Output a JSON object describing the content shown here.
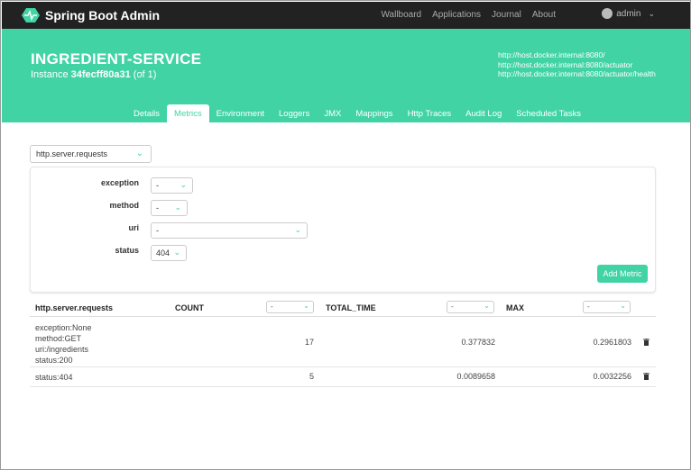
{
  "app": {
    "brand": "Spring Boot Admin",
    "nav": [
      "Wallboard",
      "Applications",
      "Journal",
      "About"
    ],
    "user": "admin"
  },
  "service": {
    "name": "INGREDIENT-SERVICE",
    "instance_prefix": "Instance",
    "instance_id": "34fecff80a31",
    "instance_suffix": "(of 1)",
    "urls": [
      "http://host.docker.internal:8080/",
      "http://host.docker.internal:8080/actuator",
      "http://host.docker.internal:8080/actuator/health"
    ]
  },
  "tabs": [
    {
      "label": "Details"
    },
    {
      "label": "Metrics",
      "active": true
    },
    {
      "label": "Environment"
    },
    {
      "label": "Loggers"
    },
    {
      "label": "JMX"
    },
    {
      "label": "Mappings"
    },
    {
      "label": "Http Traces"
    },
    {
      "label": "Audit Log"
    },
    {
      "label": "Scheduled Tasks"
    }
  ],
  "metric_select": {
    "value": "http.server.requests"
  },
  "filters": [
    {
      "label": "exception",
      "value": "-"
    },
    {
      "label": "method",
      "value": "-"
    },
    {
      "label": "uri",
      "value": "-"
    },
    {
      "label": "status",
      "value": "404"
    }
  ],
  "add_metric_label": "Add Metric",
  "table": {
    "metric_name": "http.server.requests",
    "columns": [
      {
        "label": "COUNT",
        "select": "-"
      },
      {
        "label": "TOTAL_TIME",
        "select": "-"
      },
      {
        "label": "MAX",
        "select": "-"
      }
    ],
    "rows": [
      {
        "tags": [
          "exception:None",
          "method:GET",
          "uri:/ingredients",
          "status:200"
        ],
        "count": "17",
        "total_time": "0.377832",
        "max": "0.2961803"
      },
      {
        "tags": [
          "status:404"
        ],
        "count": "5",
        "total_time": "0.0089658",
        "max": "0.0032256"
      }
    ]
  },
  "colors": {
    "accent": "#42d3a5",
    "topbar": "#222222"
  }
}
